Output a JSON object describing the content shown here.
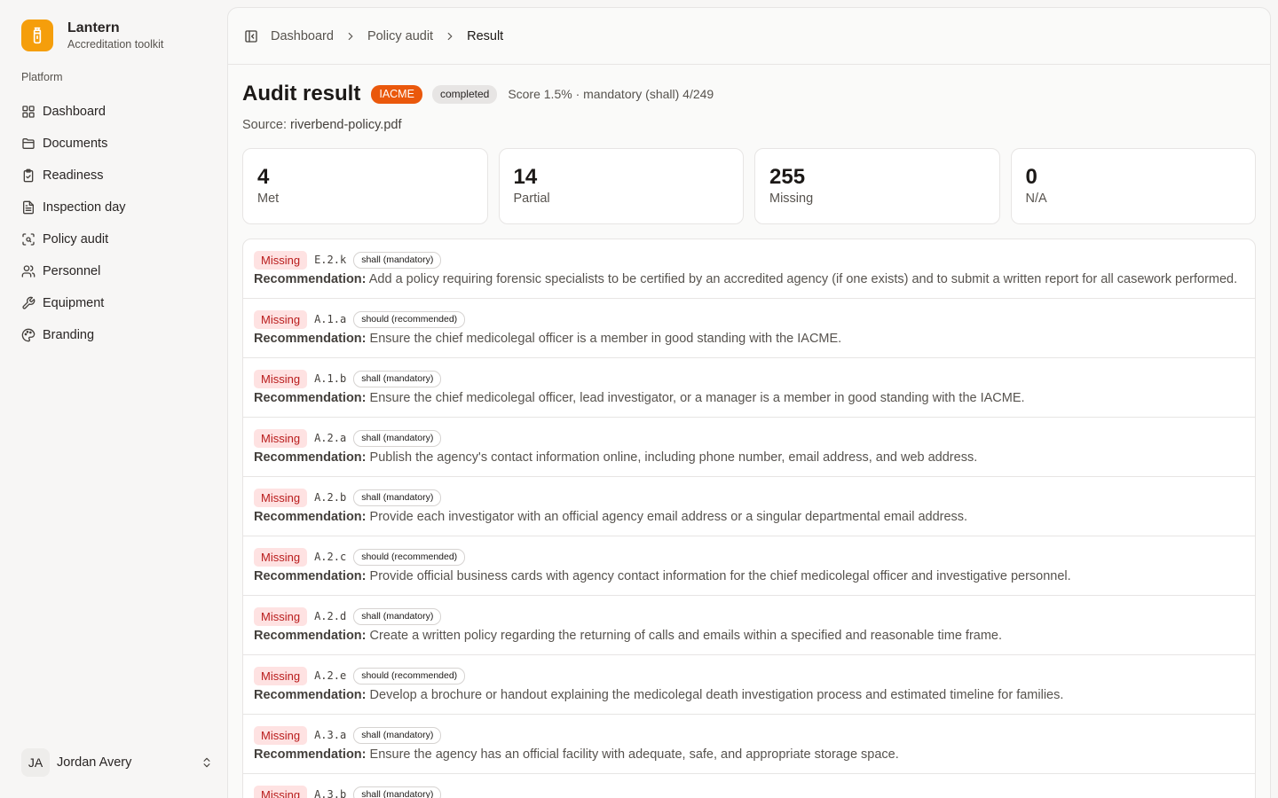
{
  "brand": {
    "name": "Lantern",
    "subtitle": "Accreditation toolkit",
    "color": "#f59e0b"
  },
  "sidebar": {
    "section_label": "Platform",
    "items": [
      {
        "label": "Dashboard",
        "icon": "grid-icon"
      },
      {
        "label": "Documents",
        "icon": "folder-icon"
      },
      {
        "label": "Readiness",
        "icon": "clipboard-check-icon"
      },
      {
        "label": "Inspection day",
        "icon": "file-text-icon"
      },
      {
        "label": "Policy audit",
        "icon": "scan-search-icon"
      },
      {
        "label": "Personnel",
        "icon": "users-icon"
      },
      {
        "label": "Equipment",
        "icon": "wrench-icon"
      },
      {
        "label": "Branding",
        "icon": "palette-icon"
      }
    ],
    "user": {
      "initials": "JA",
      "name": "Jordan Avery"
    }
  },
  "breadcrumb": [
    "Dashboard",
    "Policy audit",
    "Result"
  ],
  "header": {
    "title": "Audit result",
    "org_badge": "IACME",
    "status_badge": "completed",
    "score_text": "Score 1.5% · mandatory (shall) 4/249",
    "source_label": "Source:",
    "source_file": "riverbend-policy.pdf"
  },
  "stats": [
    {
      "value": "4",
      "label": "Met"
    },
    {
      "value": "14",
      "label": "Partial"
    },
    {
      "value": "255",
      "label": "Missing"
    },
    {
      "value": "0",
      "label": "N/A"
    }
  ],
  "recommendation_label": "Recommendation:",
  "findings": [
    {
      "status": "Missing",
      "code": "E.2.k",
      "level": "shall (mandatory)",
      "text": "Add a policy requiring forensic specialists to be certified by an accredited agency (if one exists) and to submit a written report for all casework performed."
    },
    {
      "status": "Missing",
      "code": "A.1.a",
      "level": "should (recommended)",
      "text": "Ensure the chief medicolegal officer is a member in good standing with the IACME."
    },
    {
      "status": "Missing",
      "code": "A.1.b",
      "level": "shall (mandatory)",
      "text": "Ensure the chief medicolegal officer, lead investigator, or a manager is a member in good standing with the IACME."
    },
    {
      "status": "Missing",
      "code": "A.2.a",
      "level": "shall (mandatory)",
      "text": "Publish the agency's contact information online, including phone number, email address, and web address."
    },
    {
      "status": "Missing",
      "code": "A.2.b",
      "level": "shall (mandatory)",
      "text": "Provide each investigator with an official agency email address or a singular departmental email address."
    },
    {
      "status": "Missing",
      "code": "A.2.c",
      "level": "should (recommended)",
      "text": "Provide official business cards with agency contact information for the chief medicolegal officer and investigative personnel."
    },
    {
      "status": "Missing",
      "code": "A.2.d",
      "level": "shall (mandatory)",
      "text": "Create a written policy regarding the returning of calls and emails within a specified and reasonable time frame."
    },
    {
      "status": "Missing",
      "code": "A.2.e",
      "level": "should (recommended)",
      "text": "Develop a brochure or handout explaining the medicolegal death investigation process and estimated timeline for families."
    },
    {
      "status": "Missing",
      "code": "A.3.a",
      "level": "shall (mandatory)",
      "text": "Ensure the agency has an official facility with adequate, safe, and appropriate storage space."
    },
    {
      "status": "Missing",
      "code": "A.3.b",
      "level": "shall (mandatory)",
      "text": ""
    }
  ]
}
